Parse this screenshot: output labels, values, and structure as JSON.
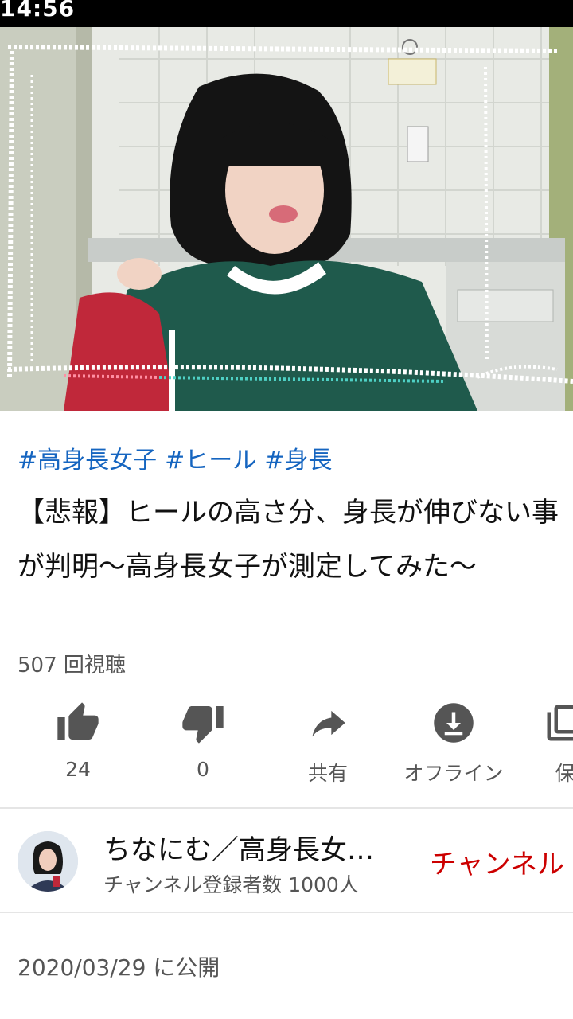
{
  "status_bar": {
    "time": "14:56"
  },
  "video": {
    "thumbnail": "woman-in-green-sweater-frame"
  },
  "hashtags": [
    "#高身長女子",
    "#ヒール",
    "#身長"
  ],
  "title": "【悲報】ヒールの高さ分、身長が伸びない事が判明〜高身長女子が測定してみた〜",
  "views": "507 回視聴",
  "actions": {
    "like": {
      "icon": "thumbs-up-icon",
      "label": "24"
    },
    "dislike": {
      "icon": "thumbs-down-icon",
      "label": "0"
    },
    "share": {
      "icon": "share-icon",
      "label": "共有"
    },
    "offline": {
      "icon": "download-icon",
      "label": "オフライン"
    },
    "save": {
      "icon": "save-icon",
      "label": "保"
    }
  },
  "channel": {
    "name": "ちなにむ／高身長女…",
    "subscribers": "チャンネル登録者数 1000人",
    "subscribe_label": "チャンネル"
  },
  "published": "2020/03/29 に公開",
  "colors": {
    "link": "#1565c0",
    "subscribe": "#cc0000",
    "secondary_text": "#555555"
  }
}
